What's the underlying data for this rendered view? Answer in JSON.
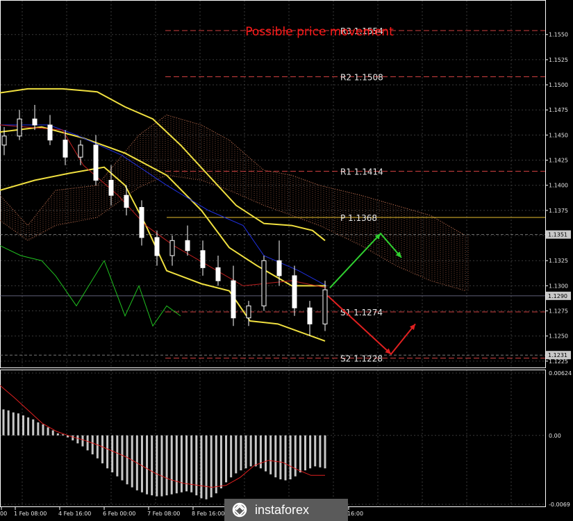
{
  "chart_data": [
    {
      "type": "line",
      "annotation": "Possible price movement",
      "y_ticks": [
        "1.1550",
        "1.1525",
        "1.1500",
        "1.1475",
        "1.1450",
        "1.1425",
        "1.1400",
        "1.1375",
        "1.1350",
        "1.1325",
        "1.1300",
        "1.1275",
        "1.1250",
        "1.1225"
      ],
      "x_ticks": [
        "00",
        "1 Feb 08:00",
        "4 Feb 16:00",
        "6 Feb 00:00",
        "7 Feb 08:00",
        "8 Feb 16:00",
        "16:00"
      ],
      "ylim": [
        1.1218,
        1.1583
      ],
      "grid": true,
      "levels": [
        {
          "name": "R3",
          "value": 1.1554,
          "text": "R3 1.1554",
          "color": "#d04040"
        },
        {
          "name": "R2",
          "value": 1.1508,
          "text": "R2 1.1508",
          "color": "#d04040"
        },
        {
          "name": "R1",
          "value": 1.1414,
          "text": "R1 1.1414",
          "color": "#d04040"
        },
        {
          "name": "P",
          "value": 1.1368,
          "text": "P 1.1368",
          "color": "#e8c030"
        },
        {
          "name": "S1",
          "value": 1.1274,
          "text": "S1 1.1274",
          "color": "#d04040"
        },
        {
          "name": "S2",
          "value": 1.1228,
          "text": "S2 1.1228",
          "color": "#d04040"
        }
      ],
      "price_tags": [
        {
          "value": 1.1351,
          "text": "1.1351"
        },
        {
          "value": 1.129,
          "text": "1.1290"
        },
        {
          "value": 1.1231,
          "text": "1.1231"
        }
      ],
      "series": [
        {
          "role": "bollinger-upper",
          "color": "#f0e040",
          "values": [
            1.1492,
            1.1496,
            1.1496,
            1.1493,
            1.1478,
            1.1466,
            1.144,
            1.141,
            1.138,
            1.1362,
            1.136,
            1.1355,
            1.1345
          ]
        },
        {
          "role": "bollinger-middle",
          "color": "#f0e040",
          "values": [
            1.1453,
            1.1458,
            1.1447,
            1.1432,
            1.141,
            1.1375,
            1.1338,
            1.132,
            1.13,
            1.13
          ]
        },
        {
          "role": "bollinger-lower",
          "color": "#f0e040",
          "values": [
            1.1395,
            1.1405,
            1.1412,
            1.1418,
            1.14,
            1.136,
            1.1315,
            1.1302,
            1.1295,
            1.1265,
            1.1262,
            1.1245
          ]
        },
        {
          "role": "kijun",
          "color": "#2030e0",
          "values": [
            1.146,
            1.146,
            1.145,
            1.143,
            1.14,
            1.1375,
            1.136,
            1.133,
            1.1315,
            1.13
          ]
        },
        {
          "role": "tenkan",
          "color": "#c02020",
          "values": [
            1.146,
            1.1455,
            1.142,
            1.139,
            1.136,
            1.134,
            1.132,
            1.13,
            1.1305,
            1.1298
          ]
        },
        {
          "role": "chikou",
          "color": "#20c020",
          "values": [
            1.134,
            1.133,
            1.1325,
            1.131,
            1.128,
            1.1325,
            1.127,
            1.13,
            1.126,
            1.128,
            1.127
          ]
        }
      ],
      "candles": [
        [
          1.144,
          1.1458,
          1.143,
          1.1449
        ],
        [
          1.1449,
          1.1475,
          1.1445,
          1.1466
        ],
        [
          1.1466,
          1.148,
          1.1455,
          1.146
        ],
        [
          1.146,
          1.147,
          1.144,
          1.1445
        ],
        [
          1.1445,
          1.1455,
          1.142,
          1.1428
        ],
        [
          1.1428,
          1.1445,
          1.142,
          1.144
        ],
        [
          1.144,
          1.145,
          1.14,
          1.1405
        ],
        [
          1.1405,
          1.142,
          1.138,
          1.139
        ],
        [
          1.139,
          1.14,
          1.137,
          1.1378
        ],
        [
          1.1378,
          1.1385,
          1.134,
          1.1348
        ],
        [
          1.1348,
          1.1355,
          1.132,
          1.133
        ],
        [
          1.133,
          1.135,
          1.132,
          1.1345
        ],
        [
          1.1345,
          1.136,
          1.133,
          1.1335
        ],
        [
          1.1335,
          1.1345,
          1.131,
          1.1318
        ],
        [
          1.1318,
          1.133,
          1.13,
          1.1305
        ],
        [
          1.1305,
          1.132,
          1.126,
          1.1268
        ],
        [
          1.1268,
          1.1285,
          1.126,
          1.128
        ],
        [
          1.128,
          1.133,
          1.1275,
          1.1325
        ],
        [
          1.1325,
          1.1345,
          1.13,
          1.131
        ],
        [
          1.131,
          1.132,
          1.127,
          1.1278
        ],
        [
          1.1278,
          1.1285,
          1.125,
          1.1262
        ],
        [
          1.1262,
          1.1305,
          1.1255,
          1.1296
        ]
      ],
      "forecast": {
        "up": {
          "color": "#30d030",
          "points": [
            [
              1.1298
            ],
            [
              1.1352
            ],
            [
              1.1328
            ]
          ]
        },
        "down": {
          "color": "#e02020",
          "points": [
            [
              1.129
            ],
            [
              1.1232
            ],
            [
              1.1262
            ]
          ]
        }
      }
    },
    {
      "type": "bar",
      "role": "macd",
      "y_ticks": [
        "0.00624",
        "0.00",
        "-0.0069"
      ],
      "ylim": [
        -0.0069,
        0.00624
      ],
      "histogram_color": "#c8c8c8",
      "signal_color": "#e02020",
      "histogram": [
        0.0026,
        0.0025,
        0.0023,
        0.0022,
        0.002,
        0.0018,
        0.0016,
        0.0013,
        0.0011,
        0.0008,
        0.0005,
        0.0002,
        0.0001,
        -0.0002,
        -0.0005,
        -0.0008,
        -0.0011,
        -0.0015,
        -0.0019,
        -0.0023,
        -0.0028,
        -0.0033,
        -0.0037,
        -0.0041,
        -0.0045,
        -0.0049,
        -0.0052,
        -0.0055,
        -0.0057,
        -0.0059,
        -0.006,
        -0.0061,
        -0.0061,
        -0.006,
        -0.0059,
        -0.0058,
        -0.0057,
        -0.0056,
        -0.0057,
        -0.006,
        -0.0063,
        -0.0064,
        -0.0062,
        -0.0058,
        -0.0053,
        -0.0047,
        -0.0042,
        -0.0038,
        -0.0035,
        -0.0033,
        -0.0031,
        -0.0031,
        -0.0033,
        -0.0036,
        -0.0039,
        -0.0042,
        -0.0044,
        -0.0045,
        -0.0044,
        -0.0041,
        -0.0037,
        -0.0035,
        -0.0033,
        -0.0031,
        -0.0032,
        -0.0033
      ],
      "signal": [
        0.005,
        0.0038,
        0.0025,
        0.0012,
        0.0004,
        -0.0001,
        -0.0005,
        -0.001,
        -0.0016,
        -0.0022,
        -0.003,
        -0.0038,
        -0.0044,
        -0.0048,
        -0.005,
        -0.0052,
        -0.005,
        -0.0042,
        -0.003,
        -0.0025,
        -0.0027,
        -0.0034,
        -0.004,
        -0.004
      ]
    }
  ],
  "branding": {
    "watermark": "instaforex"
  },
  "colors": {
    "grid": "#3a3a3a",
    "frame": "#ffffff",
    "cloud": "#c07050"
  }
}
